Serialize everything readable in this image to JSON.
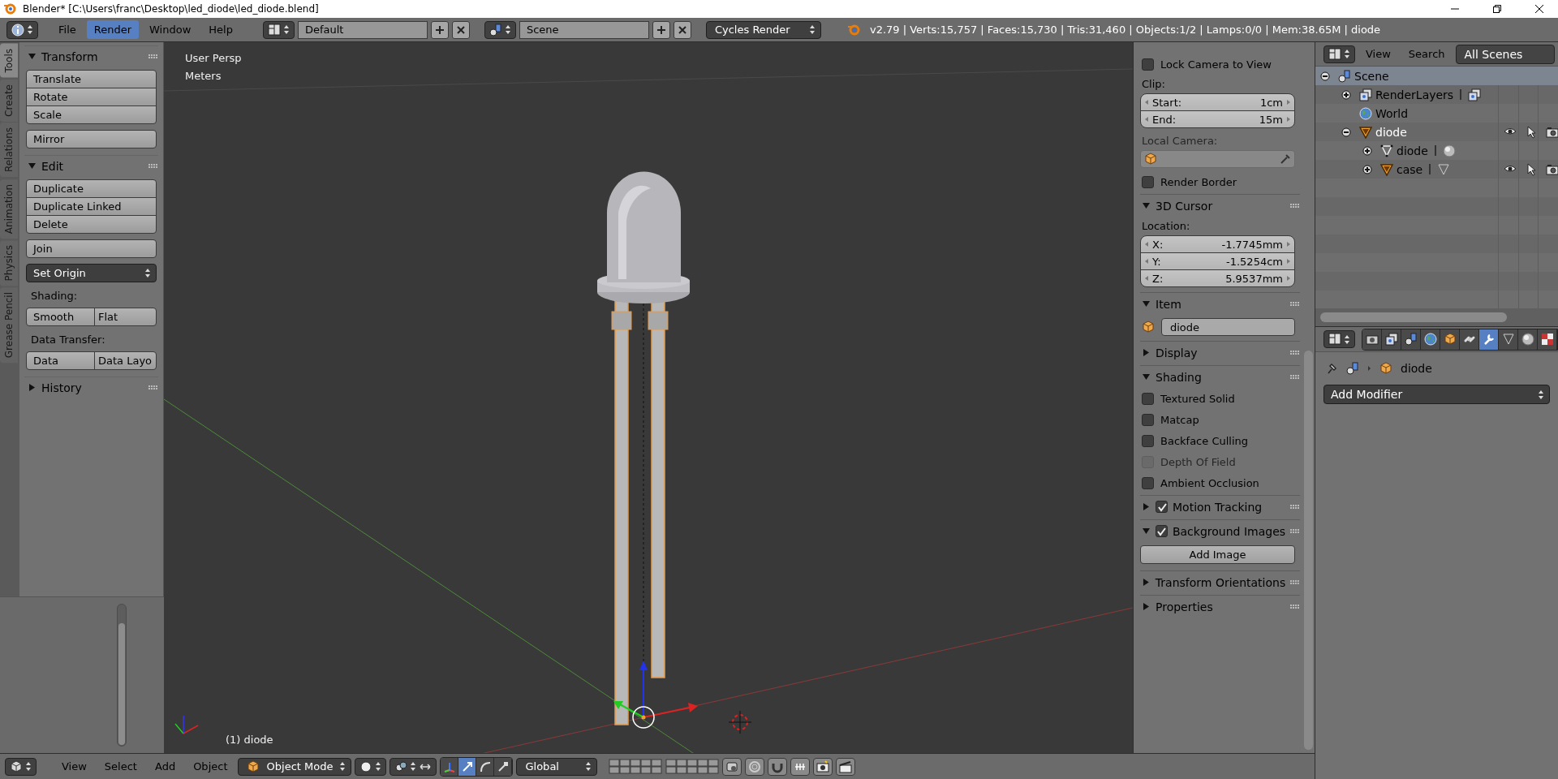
{
  "window": {
    "title": "Blender* [C:\\Users\\franc\\Desktop\\led_diode\\led_diode.blend]"
  },
  "info_header": {
    "menus": [
      {
        "label": "File",
        "selected": false
      },
      {
        "label": "Render",
        "selected": true
      },
      {
        "label": "Window",
        "selected": false
      },
      {
        "label": "Help",
        "selected": false
      }
    ],
    "layout": "Default",
    "scene": "Scene",
    "engine": "Cycles Render",
    "stats": "v2.79 | Verts:15,757 | Faces:15,730 | Tris:31,460 | Objects:1/2 | Lamps:0/0 | Mem:38.65M | diode"
  },
  "tool_tabs": [
    {
      "label": "Tools",
      "selected": true
    },
    {
      "label": "Create",
      "selected": false
    },
    {
      "label": "Relations",
      "selected": false
    },
    {
      "label": "Animation",
      "selected": false
    },
    {
      "label": "Physics",
      "selected": false
    },
    {
      "label": "Grease Pencil",
      "selected": false
    }
  ],
  "tool_panels": [
    {
      "title": "Transform",
      "expanded": true,
      "items": [
        {
          "kind": "column",
          "labels": [
            "Translate",
            "Rotate",
            "Scale"
          ]
        },
        {
          "kind": "column",
          "labels": [
            "Mirror"
          ]
        }
      ]
    },
    {
      "title": "Edit",
      "expanded": true,
      "items": [
        {
          "kind": "column",
          "labels": [
            "Duplicate",
            "Duplicate Linked",
            "Delete"
          ]
        },
        {
          "kind": "column",
          "labels": [
            "Join"
          ]
        },
        {
          "kind": "dropdown",
          "label": "Set Origin"
        },
        {
          "kind": "label",
          "label": "Shading:"
        },
        {
          "kind": "row",
          "labels": [
            "Smooth",
            "Flat"
          ]
        },
        {
          "kind": "label",
          "label": "Data Transfer:"
        },
        {
          "kind": "row",
          "labels": [
            "Data",
            "Data Layo"
          ]
        }
      ]
    },
    {
      "title": "History",
      "expanded": false
    }
  ],
  "viewport": {
    "view_name": "User Persp",
    "units": "Meters",
    "object_label": "(1) diode"
  },
  "n_panel": {
    "items": [
      {
        "kind": "checkbox",
        "label": "Lock Camera to View",
        "checked": false,
        "disabled": false
      },
      {
        "kind": "label",
        "label": "Clip:",
        "disabled": false
      },
      {
        "kind": "numbers",
        "fields": [
          {
            "label": "Start:",
            "value": "1cm"
          },
          {
            "label": "End:",
            "value": "15m"
          }
        ]
      },
      {
        "kind": "label",
        "label": "Local Camera:",
        "disabled": true
      },
      {
        "kind": "object_field",
        "disabled": true
      },
      {
        "kind": "checkbox",
        "label": "Render Border",
        "checked": false,
        "disabled": false
      },
      {
        "kind": "header",
        "label": "3D Cursor",
        "expanded": true
      },
      {
        "kind": "label",
        "label": "Location:",
        "disabled": false
      },
      {
        "kind": "numbers",
        "fields": [
          {
            "label": "X:",
            "value": "-1.7745mm"
          },
          {
            "label": "Y:",
            "value": "-1.5254cm"
          },
          {
            "label": "Z:",
            "value": "5.9537mm"
          }
        ]
      },
      {
        "kind": "header",
        "label": "Item",
        "expanded": true
      },
      {
        "kind": "name_field",
        "value": "diode"
      },
      {
        "kind": "header",
        "label": "Display",
        "expanded": false
      },
      {
        "kind": "header",
        "label": "Shading",
        "expanded": true
      },
      {
        "kind": "checkbox",
        "label": "Textured Solid",
        "checked": false,
        "disabled": false
      },
      {
        "kind": "checkbox",
        "label": "Matcap",
        "checked": false,
        "disabled": false
      },
      {
        "kind": "checkbox",
        "label": "Backface Culling",
        "checked": false,
        "disabled": false
      },
      {
        "kind": "checkbox",
        "label": "Depth Of Field",
        "checked": false,
        "disabled": true
      },
      {
        "kind": "checkbox",
        "label": "Ambient Occlusion",
        "checked": false,
        "disabled": false
      },
      {
        "kind": "header",
        "label": "Motion Tracking",
        "expanded": false,
        "checked": true
      },
      {
        "kind": "header",
        "label": "Background Images",
        "expanded": true,
        "checked": true
      },
      {
        "kind": "button",
        "label": "Add Image"
      },
      {
        "kind": "header",
        "label": "Transform Orientations",
        "expanded": false
      },
      {
        "kind": "header",
        "label": "Properties",
        "expanded": false
      }
    ]
  },
  "outliner": {
    "menus": [
      "View",
      "Search"
    ],
    "filter": "All Scenes",
    "tree": [
      {
        "kind": "scene",
        "label": "Scene",
        "expanded": true,
        "selected": true,
        "active": false,
        "restrict": false,
        "linked": false,
        "children": [
          {
            "kind": "render_layers",
            "label": "RenderLayers",
            "expanded": false,
            "selected": false,
            "active": false,
            "restrict": false,
            "linked": true
          },
          {
            "kind": "world",
            "label": "World",
            "selected": false,
            "active": false,
            "restrict": false,
            "linked": false
          },
          {
            "kind": "object",
            "label": "diode",
            "expanded": true,
            "selected": false,
            "active": true,
            "restrict": true,
            "linked": false,
            "children": [
              {
                "kind": "mesh",
                "label": "diode",
                "expanded": false,
                "selected": false,
                "active": false,
                "restrict": false,
                "linked": true
              },
              {
                "kind": "object",
                "label": "case",
                "expanded": false,
                "selected": false,
                "active": false,
                "restrict": true,
                "linked": true
              }
            ]
          }
        ]
      }
    ]
  },
  "properties": {
    "tabs": [
      {
        "kind": "render",
        "selected": false
      },
      {
        "kind": "render_layers",
        "selected": false
      },
      {
        "kind": "scene",
        "selected": false
      },
      {
        "kind": "world",
        "selected": false
      },
      {
        "kind": "object",
        "selected": false
      },
      {
        "kind": "constraints",
        "selected": false
      },
      {
        "kind": "modifiers",
        "selected": true
      },
      {
        "kind": "data",
        "selected": false
      },
      {
        "kind": "material",
        "selected": false
      },
      {
        "kind": "texture",
        "selected": false
      }
    ],
    "context": "diode",
    "add_modifier": "Add Modifier"
  },
  "view3d_header": {
    "menus": [
      "View",
      "Select",
      "Add",
      "Object"
    ],
    "mode": "Object Mode",
    "orientation": "Global",
    "manipulators": [
      {
        "kind": "axes",
        "selected": false
      },
      {
        "kind": "translate",
        "selected": true
      },
      {
        "kind": "rotate",
        "selected": false
      },
      {
        "kind": "scale",
        "selected": false
      }
    ]
  }
}
